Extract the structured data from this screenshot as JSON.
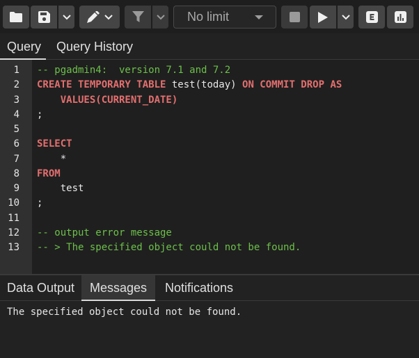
{
  "toolbar": {
    "limit_value": "No limit",
    "icons": [
      "folder-icon",
      "save-icon",
      "chevron-down-icon",
      "edit-icon",
      "chevron-down-icon",
      "filter-icon",
      "chevron-down-icon",
      "stop-icon",
      "play-icon",
      "chevron-down-icon",
      "explain-icon",
      "explain-analyze-icon"
    ]
  },
  "editor_tabs": {
    "query": "Query",
    "query_history": "Query History"
  },
  "editor": {
    "line_numbers": [
      "1",
      "2",
      "3",
      "4",
      "5",
      "6",
      "7",
      "8",
      "9",
      "10",
      "11",
      "12",
      "13"
    ],
    "lines": [
      [
        {
          "t": "-- pgadmin4:  version 7.1 and 7.2",
          "c": "cm"
        }
      ],
      [
        {
          "t": "CREATE TEMPORARY TABLE",
          "c": "kw"
        },
        {
          "t": " test(today) ",
          "c": ""
        },
        {
          "t": "ON COMMIT DROP AS",
          "c": "kw"
        }
      ],
      [
        {
          "t": "    ",
          "c": ""
        },
        {
          "t": "VALUES(CURRENT_DATE)",
          "c": "kw"
        }
      ],
      [
        {
          "t": ";",
          "c": ""
        }
      ],
      [
        {
          "t": "",
          "c": ""
        }
      ],
      [
        {
          "t": "SELECT",
          "c": "kw"
        }
      ],
      [
        {
          "t": "    *",
          "c": ""
        }
      ],
      [
        {
          "t": "FROM",
          "c": "kw"
        }
      ],
      [
        {
          "t": "    test",
          "c": ""
        }
      ],
      [
        {
          "t": ";",
          "c": ""
        }
      ],
      [
        {
          "t": "",
          "c": ""
        }
      ],
      [
        {
          "t": "-- output error message",
          "c": "cm"
        }
      ],
      [
        {
          "t": "-- > The specified object could not be found.",
          "c": "cm"
        }
      ]
    ]
  },
  "result_tabs": {
    "data_output": "Data Output",
    "messages": "Messages",
    "notifications": "Notifications"
  },
  "messages_panel": {
    "text": "The specified object could not be found."
  },
  "colors": {
    "keyword": "#e46f6f",
    "comment": "#6cc04a",
    "background": "#222222"
  }
}
